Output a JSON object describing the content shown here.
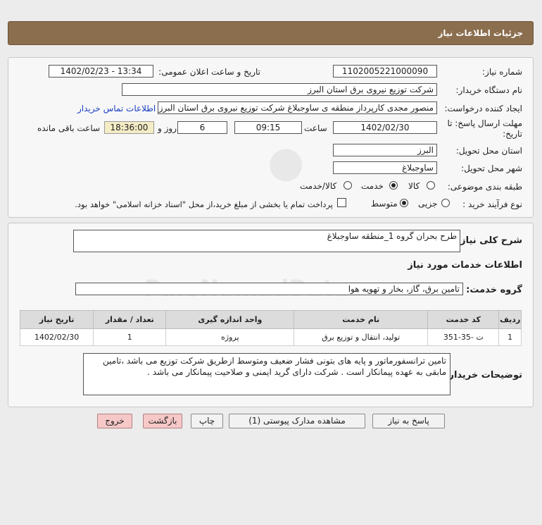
{
  "header": {
    "title": "جزئیات اطلاعات نیاز"
  },
  "form": {
    "need_number_label": "شماره نیاز:",
    "need_number": "1102005221000090",
    "announce_label": "تاریخ و ساعت اعلان عمومی:",
    "announce_value": "1402/02/23 - 13:34",
    "buyer_org_label": "نام دستگاه خریدار:",
    "buyer_org": "شرکت توزیع نیروی برق استان البرز",
    "requester_label": "ایجاد کننده درخواست:",
    "requester": "منصور مجدی کارپرداز منطقه ی ساوجبلاغ شرکت توزیع نیروی برق استان البرز",
    "contact_link": "اطلاعات تماس خریدار",
    "deadline_label_1": "مهلت ارسال پاسخ: تا",
    "deadline_label_2": "تاریخ:",
    "deadline_date": "1402/02/30",
    "time_label": "ساعت",
    "deadline_time": "09:15",
    "days_value": "6",
    "days_label": "روز و",
    "remaining_time": "18:36:00",
    "remaining_label": "ساعت باقی مانده",
    "province_label": "استان محل تحویل:",
    "province": "البرز",
    "city_label": "شهر محل تحویل:",
    "city": "ساوجبلاغ",
    "category_label": "طبقه بندی موضوعی:",
    "category_options": [
      "کالا",
      "خدمت",
      "کالا/خدمت"
    ],
    "category_selected": "خدمت",
    "process_label": "نوع فرآیند خرید :",
    "process_options": [
      "جزیی",
      "متوسط"
    ],
    "process_selected": "متوسط",
    "payment_note": "پرداخت تمام یا بخشی از مبلغ خرید،از محل \"اسناد خزانه اسلامی\" خواهد بود."
  },
  "summary": {
    "label": "شرح کلی نیاز:",
    "value": "طرح بحران گروه 1_منطقه ساوجبلاغ"
  },
  "services": {
    "section_title": "اطلاعات خدمات مورد نیاز",
    "group_label": "گروه خدمت:",
    "group_value": "تامین برق، گاز، بخار و تهویه هوا",
    "columns": [
      "ردیف",
      "کد خدمت",
      "نام خدمت",
      "واحد اندازه گیری",
      "تعداد / مقدار",
      "تاریخ نیاز"
    ],
    "rows": [
      [
        "1",
        "ت -35-351",
        "تولید، انتقال و توزیع برق",
        "پروژه",
        "1",
        "1402/02/30"
      ]
    ]
  },
  "buyer_notes": {
    "label": "توضیحات خریدار:",
    "value": "تامین ترانسفورماتور و پایه های بتونی فشار ضعیف ومتوسط ازطریق شرکت توزیع می باشد ،تامین مابقی به عهده پیمانکار است . شرکت دارای گرید ایمنی و صلاحیت پیمانکار می باشد ."
  },
  "buttons": {
    "reply": "پاسخ به نیاز",
    "attachments": "مشاهده مدارک پیوستی (1)",
    "print": "چاپ",
    "back": "بازگشت",
    "exit": "خروج"
  },
  "colors": {
    "header": "#8b6e4e",
    "link": "#1a3fc4",
    "yellow_box": "#f4ecc4",
    "pink_button": "#f7c8c8"
  }
}
